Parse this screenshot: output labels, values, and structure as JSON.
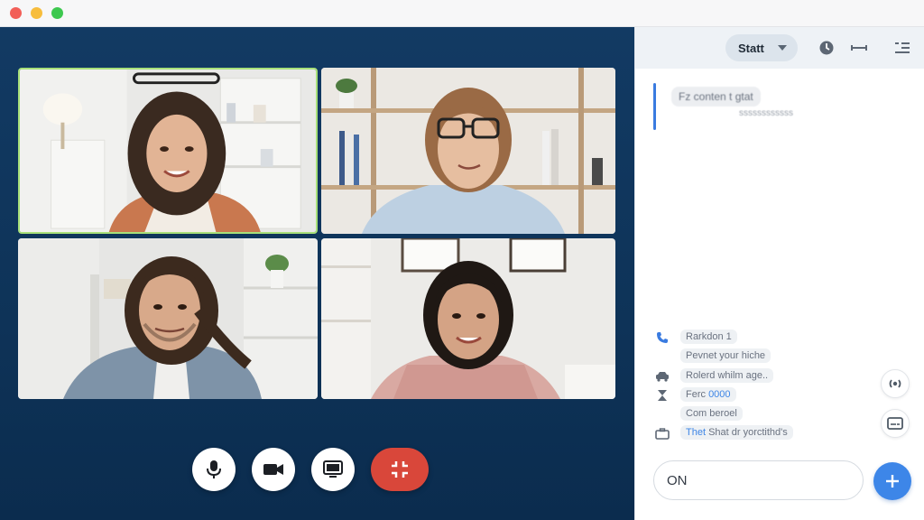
{
  "window": {
    "traffic_lights": [
      "close",
      "minimize",
      "zoom"
    ]
  },
  "participants": [
    {
      "name": "",
      "role": "active-speaker"
    },
    {
      "name": "",
      "role": "participant"
    },
    {
      "name": "",
      "role": "participant"
    },
    {
      "name": "",
      "role": "participant"
    }
  ],
  "controls": {
    "mic_icon": "microphone-icon",
    "camera_icon": "video-camera-icon",
    "share_icon": "screen-share-icon",
    "end_icon": "fullscreen-exit-icon"
  },
  "panel": {
    "status_label": "Statt",
    "header_icons": [
      "clock-icon",
      "link-icon",
      "list-icon"
    ],
    "pinned": {
      "line1": "Fz conten t gtat",
      "line2": "ssssssssssss"
    },
    "items": [
      {
        "icon": "phone-icon",
        "text": "Rarkdon 1",
        "highlight": ""
      },
      {
        "icon": "",
        "text": "Pevnet your hiche",
        "highlight": ""
      },
      {
        "icon": "car-icon",
        "text": "Rolerd whilm age..",
        "highlight": ""
      },
      {
        "icon": "hourglass-icon",
        "text": "Ferc",
        "highlight": "0000"
      },
      {
        "icon": "",
        "text": "Com beroel",
        "highlight": ""
      },
      {
        "icon": "briefcase-icon",
        "text": "Shat dr yorctithd's",
        "highlight": "Thet"
      }
    ],
    "side_buttons": [
      "broadcast-icon",
      "caption-icon"
    ],
    "composer_value": "ON",
    "send_icon": "plus-icon"
  },
  "colors": {
    "stage_bg": "#123a63",
    "end_call": "#d9473a",
    "accent": "#3d86e8",
    "active_speaker_border": "#a8e07a"
  }
}
